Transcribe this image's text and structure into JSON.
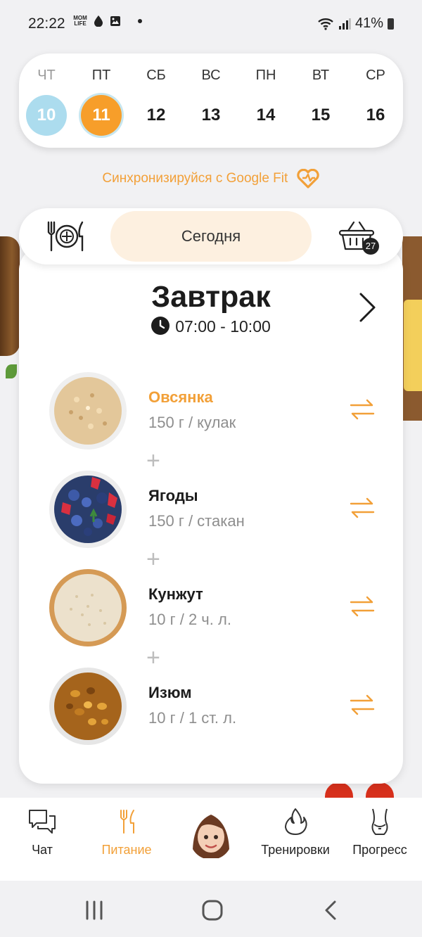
{
  "status_bar": {
    "time": "22:22",
    "app_mark": "MOM LIFE",
    "battery": "41%"
  },
  "calendar": {
    "days": [
      {
        "dow": "ЧТ",
        "num": "10",
        "state": "past"
      },
      {
        "dow": "ПТ",
        "num": "11",
        "state": "today"
      },
      {
        "dow": "СБ",
        "num": "12",
        "state": "future"
      },
      {
        "dow": "ВС",
        "num": "13",
        "state": "future"
      },
      {
        "dow": "ПН",
        "num": "14",
        "state": "future"
      },
      {
        "dow": "ВТ",
        "num": "15",
        "state": "future"
      },
      {
        "dow": "СР",
        "num": "16",
        "state": "future"
      }
    ]
  },
  "sync": {
    "label": "Синхронизируйся с Google Fit",
    "icon": "heart-icon"
  },
  "toolbar": {
    "today_label": "Сегодня",
    "basket_count": "27",
    "plate_icon": "plate-cutlery-icon",
    "basket_icon": "basket-icon"
  },
  "meal": {
    "title": "Завтрак",
    "time": "07:00 - 10:00",
    "items": [
      {
        "name": "Овсянка",
        "amount": "150 г / кулак",
        "highlight": true
      },
      {
        "name": "Ягоды",
        "amount": "150 г / стакан",
        "highlight": false
      },
      {
        "name": "Кунжут",
        "amount": "10 г / 2 ч. л.",
        "highlight": false
      },
      {
        "name": "Изюм",
        "amount": "10 г / 1 ст. л.",
        "highlight": false
      }
    ]
  },
  "nav": {
    "chat": "Чат",
    "nutrition": "Питание",
    "workouts": "Тренировки",
    "progress": "Прогресс"
  },
  "colors": {
    "accent": "#f2a038",
    "today": "#f79e2a",
    "past": "#acdcee"
  }
}
